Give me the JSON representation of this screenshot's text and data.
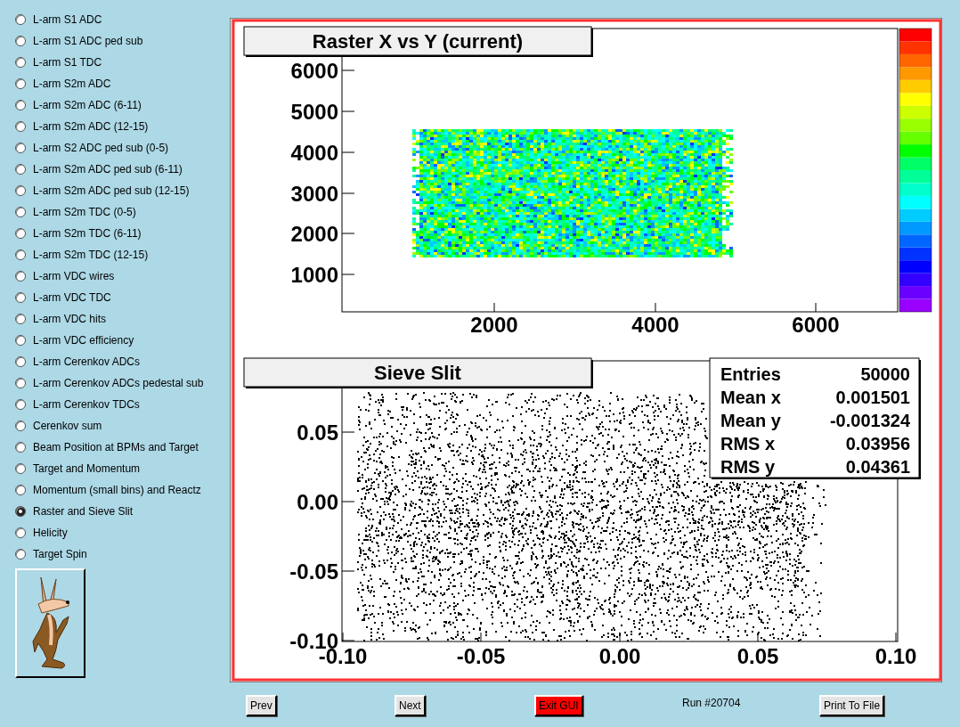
{
  "sidebar": {
    "items": [
      {
        "label": "L-arm S1 ADC",
        "selected": false
      },
      {
        "label": "L-arm S1 ADC ped sub",
        "selected": false
      },
      {
        "label": "L-arm S1 TDC",
        "selected": false
      },
      {
        "label": "L-arm S2m ADC",
        "selected": false
      },
      {
        "label": "L-arm S2m ADC (6-11)",
        "selected": false
      },
      {
        "label": "L-arm S2m ADC (12-15)",
        "selected": false
      },
      {
        "label": "L-arm S2 ADC ped sub (0-5)",
        "selected": false
      },
      {
        "label": "L-arm S2m ADC ped sub (6-11)",
        "selected": false
      },
      {
        "label": "L-arm S2m ADC ped sub (12-15)",
        "selected": false
      },
      {
        "label": "L-arm S2m TDC (0-5)",
        "selected": false
      },
      {
        "label": "L-arm S2m TDC (6-11)",
        "selected": false
      },
      {
        "label": "L-arm S2m TDC (12-15)",
        "selected": false
      },
      {
        "label": "L-arm VDC wires",
        "selected": false
      },
      {
        "label": "L-arm VDC TDC",
        "selected": false
      },
      {
        "label": "L-arm VDC hits",
        "selected": false
      },
      {
        "label": "L-arm VDC efficiency",
        "selected": false
      },
      {
        "label": "L-arm Cerenkov ADCs",
        "selected": false
      },
      {
        "label": "L-arm Cerenkov ADCs pedestal sub",
        "selected": false
      },
      {
        "label": "L-arm Cerenkov TDCs",
        "selected": false
      },
      {
        "label": "Cerenkov sum",
        "selected": false
      },
      {
        "label": "Beam Position at BPMs and Target",
        "selected": false
      },
      {
        "label": "Target and Momentum",
        "selected": false
      },
      {
        "label": "Momentum (small bins) and Reactz",
        "selected": false
      },
      {
        "label": "Raster and Sieve Slit",
        "selected": true
      },
      {
        "label": "Helicity",
        "selected": false
      },
      {
        "label": "Target Spin",
        "selected": false
      }
    ]
  },
  "canvas": {
    "pads": [
      {
        "kind": "heatmap",
        "title": "Raster X vs Y (current)",
        "y_tick_labels": [
          "6000",
          "5000",
          "4000",
          "3000",
          "2000",
          "1000"
        ],
        "x_tick_labels": [
          "2000",
          "4000",
          "6000"
        ]
      },
      {
        "kind": "scatter",
        "title": "Sieve Slit",
        "y_tick_labels": [
          "0.05",
          "0.00",
          "-0.05",
          "-0.10"
        ],
        "x_tick_labels": [
          "-0.10",
          "-0.05",
          "0.00",
          "0.05",
          "0.10"
        ],
        "stats": [
          {
            "label": "Entries",
            "value": "50000"
          },
          {
            "label": "Mean x",
            "value": "0.001501"
          },
          {
            "label": "Mean y",
            "value": "-0.001324"
          },
          {
            "label": "RMS x",
            "value": "0.03956"
          },
          {
            "label": "RMS y",
            "value": "0.04361"
          }
        ]
      }
    ]
  },
  "footer": {
    "items": [
      {
        "kind": "button",
        "label": "Prev"
      },
      {
        "kind": "button",
        "label": "Next"
      },
      {
        "kind": "danger",
        "label": "Exit GUI"
      },
      {
        "kind": "text",
        "label": "Run #20704"
      },
      {
        "kind": "button",
        "label": "Print To File"
      }
    ]
  }
}
